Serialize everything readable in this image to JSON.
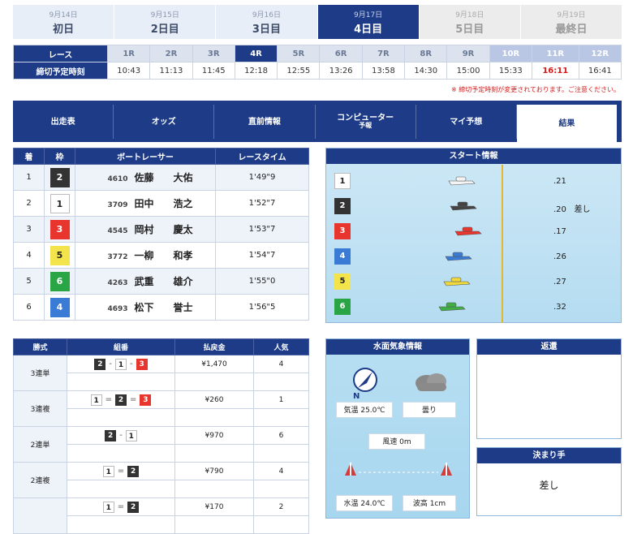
{
  "days": [
    {
      "date": "9月14日",
      "label": "初日",
      "state": "past"
    },
    {
      "date": "9月15日",
      "label": "2日目",
      "state": "past"
    },
    {
      "date": "9月16日",
      "label": "3日目",
      "state": "past"
    },
    {
      "date": "9月17日",
      "label": "4日目",
      "state": "active"
    },
    {
      "date": "9月18日",
      "label": "5日目",
      "state": "future"
    },
    {
      "date": "9月19日",
      "label": "最終日",
      "state": "future"
    }
  ],
  "race_header": "レース",
  "deadline_header": "締切予定時刻",
  "races": [
    {
      "r": "1R",
      "t": "10:43"
    },
    {
      "r": "2R",
      "t": "11:13"
    },
    {
      "r": "3R",
      "t": "11:45"
    },
    {
      "r": "4R",
      "t": "12:18"
    },
    {
      "r": "5R",
      "t": "12:55"
    },
    {
      "r": "6R",
      "t": "13:26"
    },
    {
      "r": "7R",
      "t": "13:58"
    },
    {
      "r": "8R",
      "t": "14:30"
    },
    {
      "r": "9R",
      "t": "15:00"
    },
    {
      "r": "10R",
      "t": "15:33"
    },
    {
      "r": "11R",
      "t": "16:11"
    },
    {
      "r": "12R",
      "t": "16:41"
    }
  ],
  "notice": "※ 締切予定時刻が変更されております。ご注意ください。",
  "nav": [
    "出走表",
    "オッズ",
    "直前情報",
    "コンピューター",
    "予報",
    "マイ予想",
    "結果"
  ],
  "result_headers": [
    "着",
    "枠",
    "ボートレーサー",
    "レースタイム"
  ],
  "results": [
    {
      "rank": "1",
      "waku": "2",
      "reg": "4610",
      "name": "佐藤　　大佑",
      "time": "1'49\"9"
    },
    {
      "rank": "2",
      "waku": "1",
      "reg": "3709",
      "name": "田中　　浩之",
      "time": "1'52\"7"
    },
    {
      "rank": "3",
      "waku": "3",
      "reg": "4545",
      "name": "岡村　　慶太",
      "time": "1'53\"7"
    },
    {
      "rank": "4",
      "waku": "5",
      "reg": "3772",
      "name": "一柳　　和孝",
      "time": "1'54\"7"
    },
    {
      "rank": "5",
      "waku": "6",
      "reg": "4263",
      "name": "武重　　雄介",
      "time": "1'55\"0"
    },
    {
      "rank": "6",
      "waku": "4",
      "reg": "4693",
      "name": "松下　　誉士",
      "time": "1'56\"5"
    }
  ],
  "start_title": "スタート情報",
  "start_rows": [
    {
      "waku": "1",
      "st": ".21",
      "note": ""
    },
    {
      "waku": "2",
      "st": ".20",
      "note": "差し"
    },
    {
      "waku": "3",
      "st": ".17",
      "note": ""
    },
    {
      "waku": "4",
      "st": ".26",
      "note": ""
    },
    {
      "waku": "5",
      "st": ".27",
      "note": ""
    },
    {
      "waku": "6",
      "st": ".32",
      "note": ""
    }
  ],
  "pay_headers": [
    "勝式",
    "組番",
    "払戻金",
    "人気"
  ],
  "payouts": [
    {
      "kind": "3連単",
      "combo": [
        "2",
        "-",
        "1",
        "-",
        "3"
      ],
      "amount": "¥1,470",
      "pop": "4"
    },
    {
      "kind": "3連複",
      "combo": [
        "1",
        "=",
        "2",
        "=",
        "3"
      ],
      "amount": "¥260",
      "pop": "1"
    },
    {
      "kind": "2連単",
      "combo": [
        "2",
        "-",
        "1"
      ],
      "amount": "¥970",
      "pop": "6"
    },
    {
      "kind": "2連複",
      "combo": [
        "1",
        "=",
        "2"
      ],
      "amount": "¥790",
      "pop": "4"
    },
    {
      "kind": "",
      "combo": [
        "1",
        "=",
        "2"
      ],
      "amount": "¥170",
      "pop": "2"
    }
  ],
  "weather_title": "水面気象情報",
  "weather": {
    "air": "気温 25.0℃",
    "sky": "曇り",
    "wind": "風速 0m",
    "water": "水温 24.0℃",
    "wave": "波高 1cm",
    "north": "N"
  },
  "return_title": "返還",
  "kimarite_title": "決まり手",
  "kimarite": "差し"
}
